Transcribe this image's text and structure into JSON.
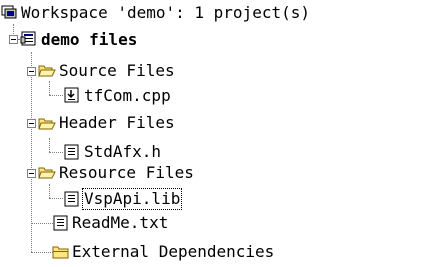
{
  "tree": {
    "root": {
      "label": "Workspace 'demo': 1 project(s)",
      "icon": "workspace-icon"
    },
    "project": {
      "label": "demo files",
      "icon": "project-icon",
      "expanded": true
    },
    "folders": [
      {
        "label": "Source Files",
        "icon": "folder-open-icon",
        "expanded": true,
        "files": [
          {
            "label": "tfCom.cpp",
            "icon": "cpp-file-icon"
          }
        ]
      },
      {
        "label": "Header Files",
        "icon": "folder-open-icon",
        "expanded": true,
        "files": [
          {
            "label": "StdAfx.h",
            "icon": "header-file-icon"
          }
        ]
      },
      {
        "label": "Resource Files",
        "icon": "folder-open-icon",
        "expanded": true,
        "files": [
          {
            "label": "VspApi.lib",
            "icon": "lib-file-icon",
            "selected": true
          }
        ]
      }
    ],
    "readme": {
      "label": "ReadMe.txt",
      "icon": "text-file-icon"
    },
    "external": {
      "label": "External Dependencies",
      "icon": "folder-closed-icon"
    }
  },
  "colors": {
    "folder_fill": "#ffe680",
    "folder_stroke": "#806600",
    "connector": "#808080"
  }
}
